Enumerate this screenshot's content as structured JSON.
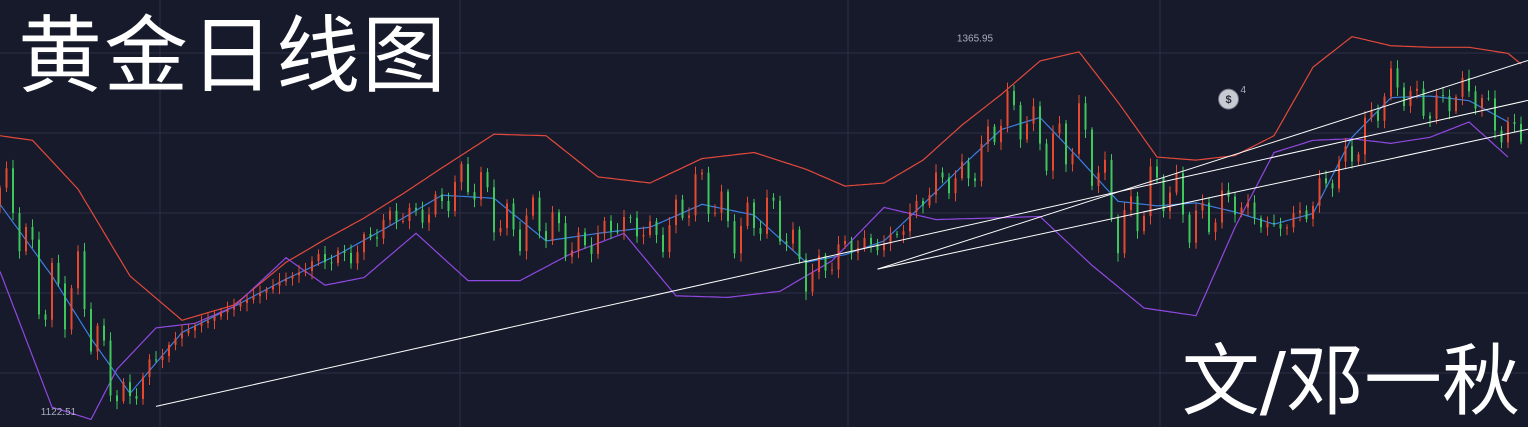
{
  "title": "黄金日线图",
  "author": "文/邓一秋",
  "colors": {
    "background": "#171a2b",
    "up_candle": "#e6492d",
    "down_candle": "#3ec75a",
    "upper_band": "#e2493b",
    "middle_band": "#3b7fe0",
    "lower_band": "#9048e0",
    "trendline": "#ffffff",
    "grid": "#2c3044"
  },
  "marker": {
    "icon": "dollar-circle-icon",
    "text": "$",
    "value": "4"
  },
  "chart_data": {
    "type": "line",
    "subtype": "candlestick-with-bollinger-bands",
    "title": "黄金日线图",
    "xlabel": "",
    "ylabel": "",
    "ylim": [
      1112,
      1392
    ],
    "x_count": 235,
    "grid": true,
    "annotations": {
      "high": "1365.95",
      "low": "1122.51"
    },
    "series": [
      {
        "name": "upper",
        "x": [
          0,
          5,
          12,
          20,
          28,
          36,
          44,
          50,
          56,
          62,
          68,
          76,
          84,
          92,
          100,
          108,
          116,
          124,
          130,
          136,
          142,
          148,
          154,
          160,
          166,
          172,
          178,
          184,
          190,
          196,
          202,
          208,
          214,
          220,
          226,
          232,
          234
        ],
        "values": [
          1303,
          1300,
          1268,
          1211,
          1182,
          1192,
          1220,
          1235,
          1249,
          1265,
          1282,
          1304,
          1303,
          1276,
          1272,
          1288,
          1292,
          1281,
          1270,
          1272,
          1287,
          1310,
          1330,
          1352,
          1358,
          1325,
          1289,
          1287,
          1290,
          1303,
          1348,
          1368,
          1362,
          1361,
          1361,
          1357,
          1350
        ]
      },
      {
        "name": "middle",
        "x": [
          0,
          8,
          14,
          20,
          28,
          36,
          44,
          52,
          60,
          68,
          76,
          84,
          92,
          100,
          108,
          116,
          124,
          130,
          136,
          142,
          148,
          154,
          160,
          166,
          172,
          178,
          184,
          190,
          196,
          202,
          208,
          214,
          220,
          226,
          232
        ],
        "values": [
          1258,
          1211,
          1170,
          1134,
          1174,
          1191,
          1209,
          1225,
          1244,
          1264,
          1262,
          1234,
          1239,
          1243,
          1258,
          1251,
          1220,
          1225,
          1234,
          1258,
          1283,
          1307,
          1315,
          1288,
          1260,
          1257,
          1259,
          1253,
          1245,
          1252,
          1302,
          1328,
          1329,
          1326,
          1312
        ]
      },
      {
        "name": "lower",
        "x": [
          0,
          8,
          14,
          18,
          24,
          30,
          36,
          44,
          50,
          56,
          64,
          72,
          80,
          88,
          96,
          104,
          112,
          120,
          128,
          136,
          144,
          152,
          160,
          168,
          176,
          184,
          190,
          196,
          202,
          208,
          214,
          220,
          226,
          232
        ],
        "values": [
          1214,
          1125,
          1117,
          1150,
          1177,
          1180,
          1191,
          1223,
          1205,
          1210,
          1239,
          1208,
          1208,
          1226,
          1239,
          1198,
          1197,
          1201,
          1221,
          1256,
          1248,
          1249,
          1250,
          1218,
          1190,
          1185,
          1243,
          1292,
          1300,
          1301,
          1298,
          1302,
          1312,
          1289
        ]
      },
      {
        "name": "trendline-1",
        "x": [
          24,
          237
        ],
        "values": [
          1125.5,
          1328.0
        ]
      },
      {
        "name": "trendline-2",
        "x": [
          135,
          237
        ],
        "values": [
          1215.5,
          1355.0
        ]
      },
      {
        "name": "trendline-3",
        "x": [
          135,
          237
        ],
        "values": [
          1215.5,
          1309.0
        ]
      }
    ]
  }
}
